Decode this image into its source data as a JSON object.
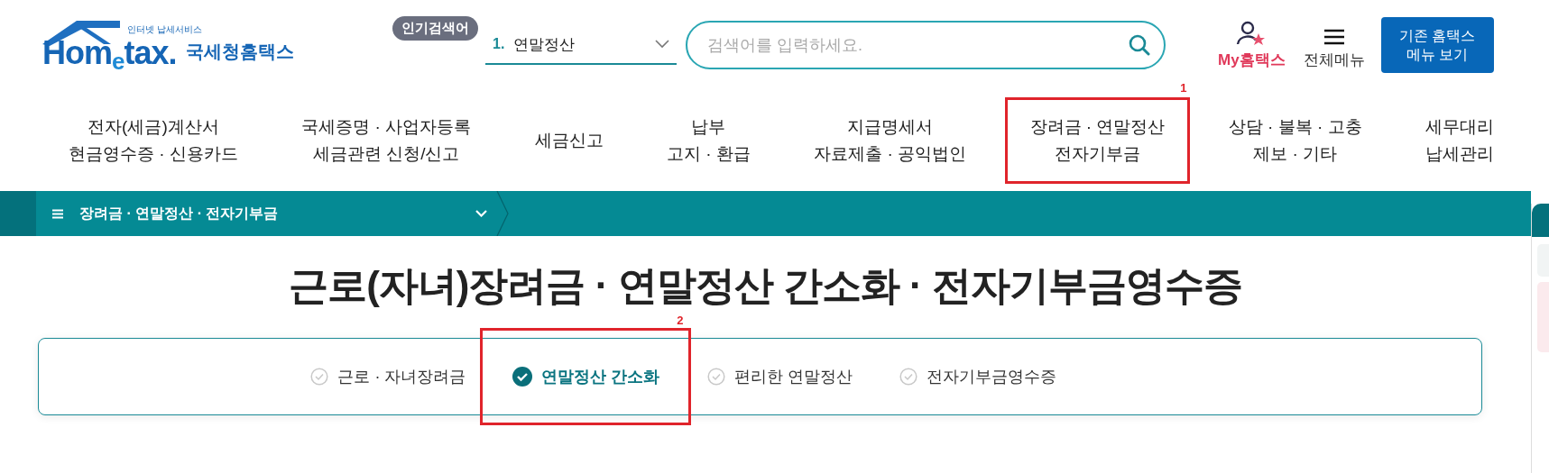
{
  "logo": {
    "tagline": "인터넷 납세서비스",
    "wordmark": "Hom$_{e}$tax.",
    "name": "국세청홈택스"
  },
  "popular_search": {
    "badge": "인기검색어",
    "rank": "1.",
    "term": "연말정산"
  },
  "search": {
    "placeholder": "검색어를 입력하세요."
  },
  "header_links": [
    {
      "kind": "my",
      "label": "My홈택스"
    },
    {
      "kind": "menu",
      "label": "전체메뉴"
    }
  ],
  "legacy_button": {
    "lines": [
      "기존 홈택스",
      "메뉴 보기"
    ]
  },
  "nav": [
    {
      "lines": [
        "전자(세금)계산서",
        "현금영수증 · 신용카드"
      ]
    },
    {
      "lines": [
        "국세증명 · 사업자등록",
        "세금관련 신청/신고"
      ]
    },
    {
      "lines": [
        "세금신고"
      ]
    },
    {
      "lines": [
        "납부",
        "고지 · 환급"
      ]
    },
    {
      "lines": [
        "지급명세서",
        "자료제출 · 공익법인"
      ]
    },
    {
      "lines": [
        "장려금 · 연말정산",
        "전자기부금"
      ],
      "annotation": "1"
    },
    {
      "lines": [
        "상담 · 불복 · 고충",
        "제보 · 기타"
      ]
    },
    {
      "lines": [
        "세무대리",
        "납세관리"
      ]
    }
  ],
  "breadcrumb": {
    "label": "장려금 · 연말정산 · 전자기부금"
  },
  "page_title": "근로(자녀)장려금 · 연말정산 간소화 · 전자기부금영수증",
  "tabs": [
    {
      "label": "근로 · 자녀장려금",
      "selected": false
    },
    {
      "label": "연말정산 간소화",
      "selected": true,
      "annotation": "2"
    },
    {
      "label": "편리한 연말정산",
      "selected": false
    },
    {
      "label": "전자기부금영수증",
      "selected": false
    }
  ]
}
